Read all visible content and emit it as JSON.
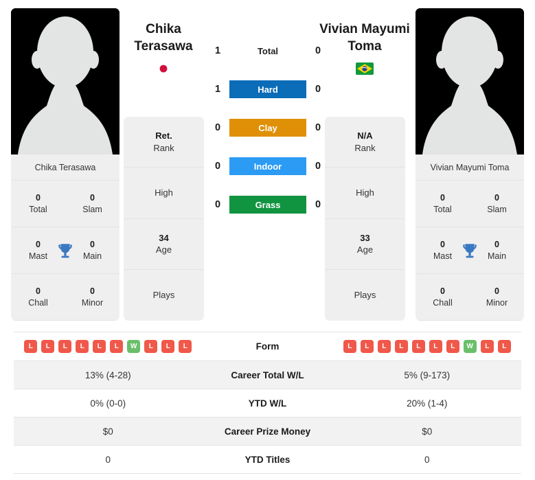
{
  "players": {
    "left": {
      "name_display": "Chika\nTerasawa",
      "name_line1": "Chika",
      "name_line2": "Terasawa",
      "photo_caption": "Chika Terasawa",
      "country": "Japan",
      "flag_icon": "flag-japan",
      "rank_value": "Ret.",
      "rank_label": "Rank",
      "high_value": "",
      "high_label": "High",
      "age_value": "34",
      "age_label": "Age",
      "plays_value": "",
      "plays_label": "Plays",
      "titles": [
        {
          "value": "0",
          "label": "Total"
        },
        {
          "value": "0",
          "label": "Slam"
        },
        {
          "value": "0",
          "label": "Mast"
        },
        {
          "value": "0",
          "label": "Main"
        },
        {
          "value": "0",
          "label": "Chall"
        },
        {
          "value": "0",
          "label": "Minor"
        }
      ],
      "form": [
        "L",
        "L",
        "L",
        "L",
        "L",
        "L",
        "W",
        "L",
        "L",
        "L"
      ],
      "career_total_wl": "13% (4-28)",
      "ytd_wl": "0% (0-0)",
      "career_prize_money": "$0",
      "ytd_titles": "0"
    },
    "right": {
      "name_display": "Vivian Mayumi\nToma",
      "name_line1": "Vivian Mayumi",
      "name_line2": "Toma",
      "photo_caption": "Vivian Mayumi Toma",
      "country": "Brazil",
      "flag_icon": "flag-brazil",
      "rank_value": "N/A",
      "rank_label": "Rank",
      "high_value": "",
      "high_label": "High",
      "age_value": "33",
      "age_label": "Age",
      "plays_value": "",
      "plays_label": "Plays",
      "titles": [
        {
          "value": "0",
          "label": "Total"
        },
        {
          "value": "0",
          "label": "Slam"
        },
        {
          "value": "0",
          "label": "Mast"
        },
        {
          "value": "0",
          "label": "Main"
        },
        {
          "value": "0",
          "label": "Chall"
        },
        {
          "value": "0",
          "label": "Minor"
        }
      ],
      "form": [
        "L",
        "L",
        "L",
        "L",
        "L",
        "L",
        "L",
        "W",
        "L",
        "L"
      ],
      "career_total_wl": "5% (9-173)",
      "ytd_wl": "20% (1-4)",
      "career_prize_money": "$0",
      "ytd_titles": "0"
    }
  },
  "head_to_head": [
    {
      "surface": "Total",
      "left": "1",
      "right": "0",
      "color": "",
      "style": "plain"
    },
    {
      "surface": "Hard",
      "left": "1",
      "right": "0",
      "color": "#0b6cb8",
      "style": "badge"
    },
    {
      "surface": "Clay",
      "left": "0",
      "right": "0",
      "color": "#e09006",
      "style": "badge"
    },
    {
      "surface": "Indoor",
      "left": "0",
      "right": "0",
      "color": "#2b9bf4",
      "style": "badge"
    },
    {
      "surface": "Grass",
      "left": "0",
      "right": "0",
      "color": "#109440",
      "style": "badge"
    }
  ],
  "stats_rows": [
    {
      "label": "Form",
      "key": "form",
      "type": "form"
    },
    {
      "label": "Career Total W/L",
      "key": "career_total_wl",
      "type": "text"
    },
    {
      "label": "YTD W/L",
      "key": "ytd_wl",
      "type": "text"
    },
    {
      "label": "Career Prize Money",
      "key": "career_prize_money",
      "type": "text"
    },
    {
      "label": "YTD Titles",
      "key": "ytd_titles",
      "type": "text"
    }
  ],
  "colors": {
    "win_badge": "#6abf69",
    "loss_badge": "#f0584a",
    "card_bg": "#efefef",
    "row_shade": "#f2f2f2",
    "trophy": "#3b78c2"
  }
}
